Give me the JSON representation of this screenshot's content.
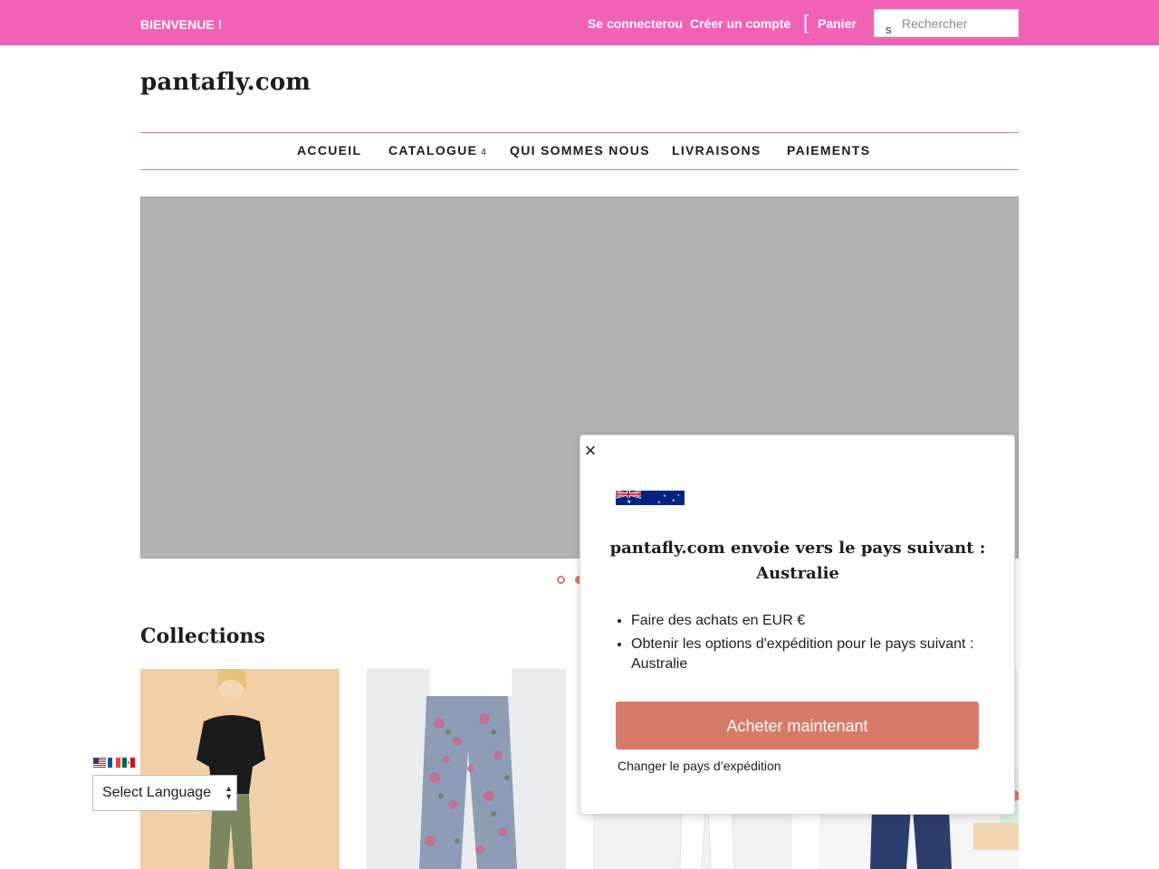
{
  "topbar": {
    "welcome": "BIENVENUE !",
    "login": "Se connecter",
    "or": "ou",
    "signup": "Créer un compte",
    "cart_icon": "[",
    "cart": "Panier",
    "search_icon": "s",
    "search_placeholder": "Rechercher",
    "color": "#f162b5"
  },
  "logo": "pantafly.com",
  "nav": {
    "items": [
      {
        "label": "ACCUEIL"
      },
      {
        "label": "CATALOGUE",
        "caret": "4"
      },
      {
        "label": "QUI SOMMES NOUS"
      },
      {
        "label": "LIVRAISONS"
      },
      {
        "label": "PAIEMENTS"
      }
    ]
  },
  "slider": {
    "active_dot": 1,
    "dot_count": 2
  },
  "collections": {
    "title": "Collections"
  },
  "language": {
    "select_label": "Select Language",
    "flags": [
      "us-flag-icon",
      "fr-flag-icon",
      "mx-flag-icon"
    ]
  },
  "popup": {
    "close_icon": "×",
    "flag": "australia-flag-icon",
    "heading_line1": "pantafly.com envoie vers le pays suivant :",
    "heading_line2": "Australie",
    "bullets": [
      "Faire des achats en EUR €",
      "Obtenir les options d'expédition pour le pays suivant : Australie"
    ],
    "buy_button": "Acheter maintenant",
    "change_link": "Changer le pays d’expédition",
    "accent": "#d67b69"
  }
}
